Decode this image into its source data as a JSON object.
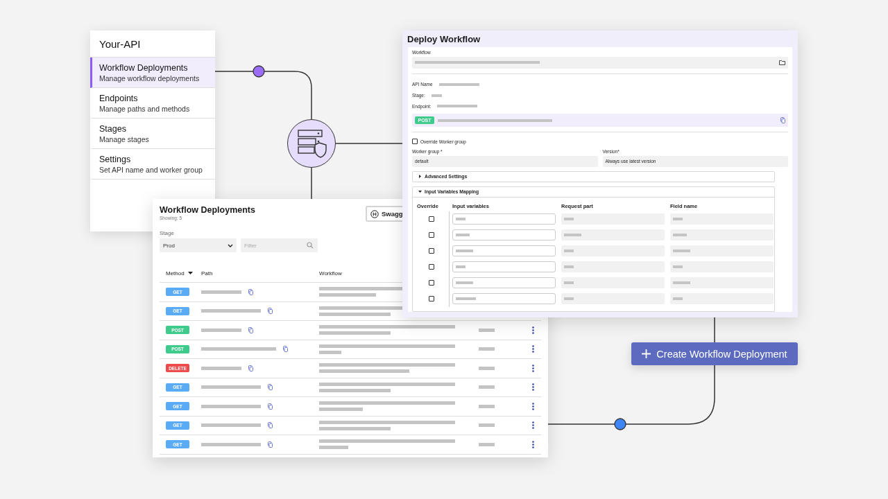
{
  "sidebar": {
    "title": "Your-API",
    "items": [
      {
        "title": "Workflow Deployments",
        "subtitle": "Manage workflow deployments",
        "selected": true
      },
      {
        "title": "Endpoints",
        "subtitle": "Manage paths and methods",
        "selected": false
      },
      {
        "title": "Stages",
        "subtitle": "Manage stages",
        "selected": false
      },
      {
        "title": "Settings",
        "subtitle": "Set API name and worker group",
        "selected": false
      }
    ]
  },
  "deployments_panel": {
    "title": "Workflow Deployments",
    "count": "Showing: 5",
    "swagger_button": "Swagg",
    "stage_label": "Stage",
    "stage_select": "Prod",
    "filter": {
      "placeholder": "Filter"
    },
    "columns": [
      "Method",
      "Path",
      "Workflow"
    ],
    "rows": [
      {
        "method": "GET",
        "color": "#5aabf6"
      },
      {
        "method": "GET",
        "color": "#5aabf6"
      },
      {
        "method": "POST",
        "color": "#3ecb8c"
      },
      {
        "method": "POST",
        "color": "#3ecb8c"
      },
      {
        "method": "DELETE",
        "color": "#ec4c4c"
      },
      {
        "method": "GET",
        "color": "#5aabf6"
      },
      {
        "method": "GET",
        "color": "#5aabf6"
      },
      {
        "method": "GET",
        "color": "#5aabf6"
      },
      {
        "method": "GET",
        "color": "#5aabf6"
      }
    ]
  },
  "deploy_dialog": {
    "title": "Deploy Workflow",
    "workflow_label": "Workflow",
    "info_labels": [
      "API Name",
      "Stage:",
      "Endpoint:"
    ],
    "endpoint_method": {
      "method": "POST",
      "color": "#3ecb8c"
    },
    "override_checkbox": {
      "label": "Override Worker group",
      "checked": false
    },
    "worker_group": {
      "label": "Worker group *",
      "value": "default"
    },
    "version": {
      "label": "Version*",
      "value": "Always use latest version"
    },
    "sections": [
      {
        "title": "Advanced Settings",
        "expanded": false
      },
      {
        "title": "Input Variables Mapping",
        "expanded": true,
        "mapping": {
          "columns": [
            "Override",
            "Input variables",
            "Request part",
            "Field name"
          ],
          "rows": [
            {
              "override": false
            },
            {
              "override": false
            },
            {
              "override": false
            },
            {
              "override": false
            },
            {
              "override": false
            },
            {
              "override": false
            }
          ]
        }
      }
    ]
  },
  "create_button": "Create Workflow Deployment"
}
